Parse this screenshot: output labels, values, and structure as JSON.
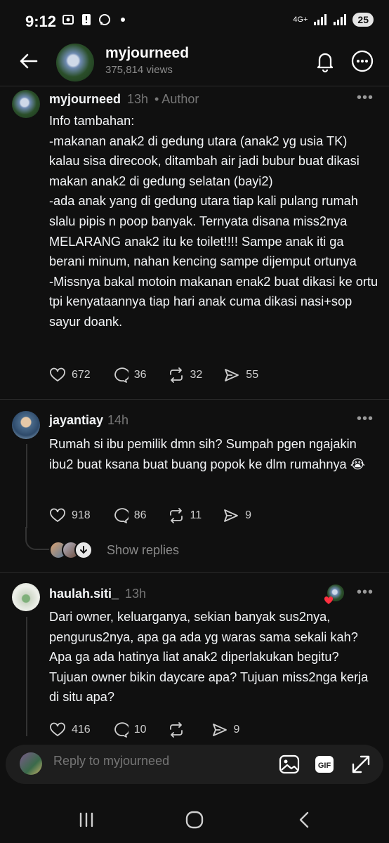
{
  "status": {
    "time": "9:12",
    "network": "4G+",
    "battery": "25"
  },
  "header": {
    "title": "myjourneed",
    "views": "375,814 views"
  },
  "posts": [
    {
      "username": "myjourneed",
      "time": "13h",
      "badge": "• Author",
      "text": "Info tambahan:\n-makanan anak2 di gedung utara (anak2 yg usia TK) kalau sisa direcook, ditambah air jadi bubur buat dikasi makan anak2 di gedung selatan (bayi2)\n-ada anak yang di gedung utara tiap kali pulang rumah slalu pipis n poop banyak. Ternyata disana miss2nya MELARANG anak2 itu ke toilet!!!! Sampe anak iti ga berani minum, nahan kencing sampe dijemput ortunya\n-Missnya bakal motoin makanan enak2 buat dikasi ke ortu tpi kenyataannya tiap hari anak cuma dikasi nasi+sop sayur doank.",
      "likes": "672",
      "comments": "36",
      "reposts": "32",
      "shares": "55"
    },
    {
      "username": "jayantiay",
      "time": "14h",
      "text": "Rumah si ibu pemilik dmn sih? Sumpah pgen ngajakin ibu2 buat ksana buat buang popok ke dlm rumahnya 😭",
      "likes": "918",
      "comments": "86",
      "reposts": "11",
      "shares": "9",
      "show_replies": "Show replies"
    },
    {
      "username": "haulah.siti_",
      "time": "13h",
      "text": "Dari owner, keluarganya, sekian banyak sus2nya, pengurus2nya, apa ga ada yg waras sama sekali kah? Apa ga ada hatinya liat anak2 diperlakukan begitu? Tujuan owner bikin daycare apa? Tujuan miss2nga kerja di situ apa?",
      "likes": "416",
      "comments": "10",
      "reposts": "",
      "shares": "9"
    }
  ],
  "composer": {
    "placeholder": "Reply to myjourneed"
  },
  "icons": [
    "back-arrow-icon",
    "bell-icon",
    "more-icon",
    "heart-icon",
    "comment-icon",
    "repost-icon",
    "share-icon",
    "image-icon",
    "gif-icon",
    "expand-icon"
  ]
}
